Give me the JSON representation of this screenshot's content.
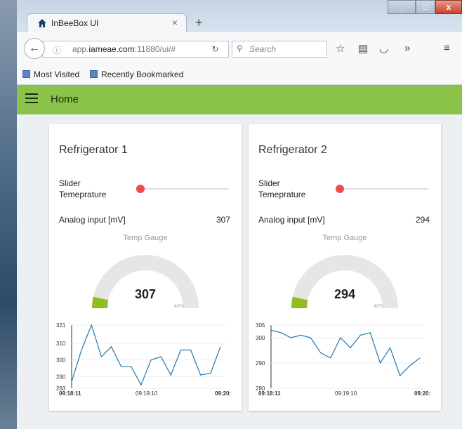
{
  "browser": {
    "tab_title": "InBeeBox UI",
    "url_prefix": "app.",
    "url_domain": "iameae.com",
    "url_suffix": ":11880/ui/#",
    "search_placeholder": "Search",
    "bookmarks": [
      "Most Visited",
      "Recently Bookmarked"
    ]
  },
  "app": {
    "title": "Home",
    "header_color": "#8bc34a"
  },
  "cards": [
    {
      "title": "Refrigerator 1",
      "slider_label_1": "Slider",
      "slider_label_2": "Temeprature",
      "slider_value": 0.0,
      "analog_label": "Analog input [mV]",
      "analog_value": "307",
      "gauge_title": "Temp Gauge",
      "gauge_value": "307",
      "gauge_min_label": "0",
      "gauge_max_label": "40%",
      "chart_data": {
        "type": "line",
        "yticks": [
          "321",
          "310",
          "300",
          "290",
          "283"
        ],
        "xticks": [
          "09:18:11",
          "09:19:10",
          "09:20:"
        ],
        "ylim": [
          283,
          321
        ],
        "values": [
          287,
          306,
          321,
          302,
          308,
          296,
          296,
          285,
          300,
          302,
          291,
          306,
          306,
          291,
          292,
          308
        ],
        "color": "#1f77b4"
      }
    },
    {
      "title": "Refrigerator 2",
      "slider_label_1": "Slider",
      "slider_label_2": "Temeprature",
      "slider_value": 0.0,
      "analog_label": "Analog input [mV]",
      "analog_value": "294",
      "gauge_title": "Temp Gauge",
      "gauge_value": "294",
      "gauge_min_label": "0",
      "gauge_max_label": "40%",
      "chart_data": {
        "type": "line",
        "yticks": [
          "305",
          "300",
          "290",
          "280"
        ],
        "xticks": [
          "09:18:11",
          "09:19:10",
          "09:20:"
        ],
        "ylim": [
          280,
          305
        ],
        "values": [
          303,
          302,
          300,
          301,
          300,
          294,
          292,
          300,
          296,
          301,
          302,
          290,
          296,
          285,
          289,
          292
        ],
        "color": "#1f77b4"
      }
    }
  ]
}
